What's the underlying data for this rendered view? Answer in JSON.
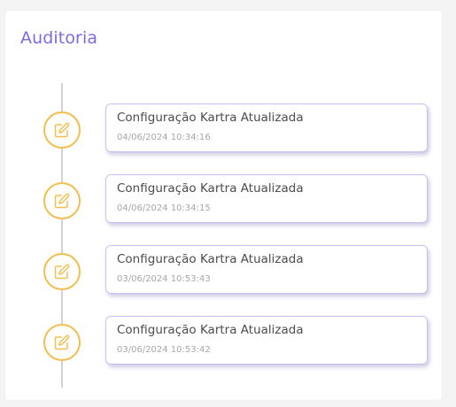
{
  "card": {
    "title": "Auditoria"
  },
  "colors": {
    "title": "#7b6be3",
    "marker": "#f2bf4d",
    "entry_border": "#c9c2f1",
    "timeline_line": "#d3d3d6"
  },
  "timeline": {
    "items": [
      {
        "title": "Configuração Kartra Atualizada",
        "timestamp": "04/06/2024 10:34:16",
        "icon": "edit-icon"
      },
      {
        "title": "Configuração Kartra Atualizada",
        "timestamp": "04/06/2024 10:34:15",
        "icon": "edit-icon"
      },
      {
        "title": "Configuração Kartra Atualizada",
        "timestamp": "03/06/2024 10:53:43",
        "icon": "edit-icon"
      },
      {
        "title": "Configuração Kartra Atualizada",
        "timestamp": "03/06/2024 10:53:42",
        "icon": "edit-icon"
      }
    ]
  }
}
